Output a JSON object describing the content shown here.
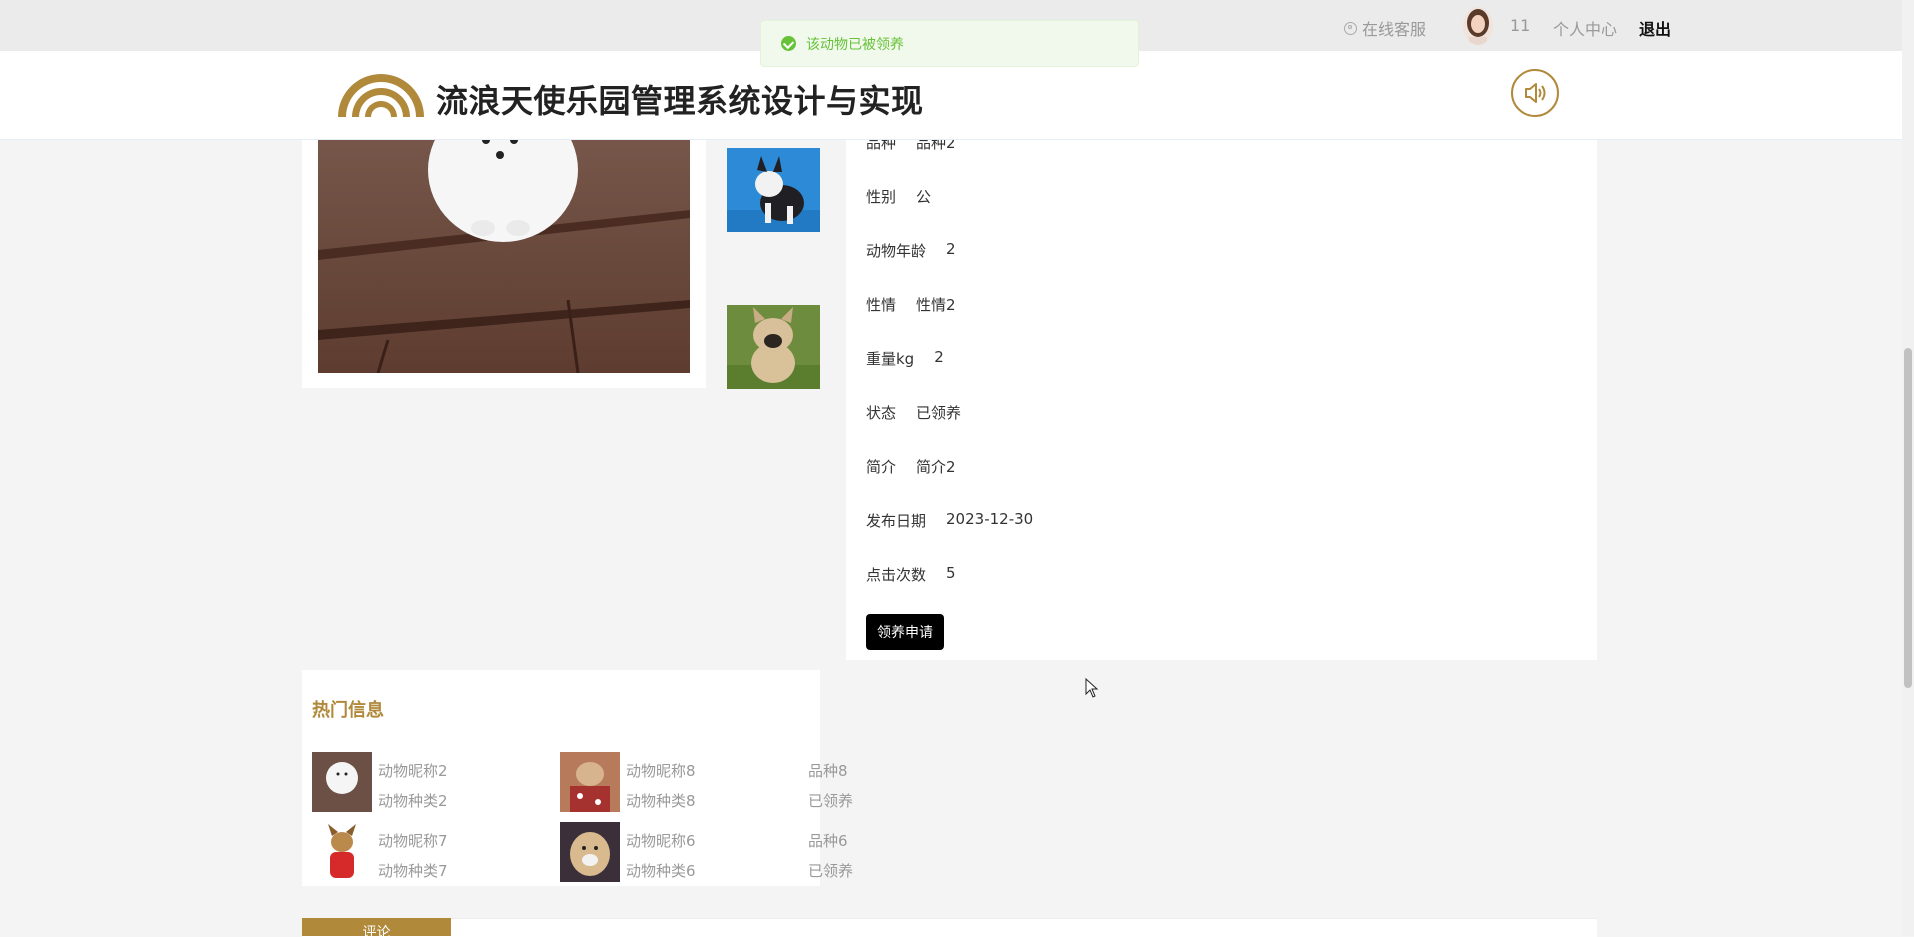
{
  "topbar": {
    "service": "在线客服",
    "username": "11",
    "center": "个人中心",
    "logout": "退出"
  },
  "toast": {
    "message": "该动物已被领养"
  },
  "header": {
    "title": "流浪天使乐园管理系统设计与实现"
  },
  "detail": {
    "rows": [
      {
        "label": "品种",
        "value": "品种2"
      },
      {
        "label": "性别",
        "value": "公"
      },
      {
        "label": "动物年龄",
        "value": "2"
      },
      {
        "label": "性情",
        "value": "性情2"
      },
      {
        "label": "重量kg",
        "value": "2"
      },
      {
        "label": "状态",
        "value": "已领养"
      },
      {
        "label": "简介",
        "value": "简介2"
      },
      {
        "label": "发布日期",
        "value": "2023-12-30"
      },
      {
        "label": "点击次数",
        "value": "5"
      }
    ],
    "adopt_button": "领养申请"
  },
  "hot": {
    "title": "热门信息",
    "items": [
      {
        "name": "动物昵称2",
        "kind": "动物种类2",
        "breed": "",
        "status": ""
      },
      {
        "name": "动物昵称8",
        "kind": "动物种类8",
        "breed": "品种8",
        "status": "已领养"
      },
      {
        "name": "动物昵称7",
        "kind": "动物种类7",
        "breed": "",
        "status": ""
      },
      {
        "name": "动物昵称6",
        "kind": "动物种类6",
        "breed": "品种6",
        "status": "已领养"
      }
    ]
  },
  "bottom": {
    "tab_label": "评论"
  },
  "colors": {
    "accent": "#b0893b",
    "success": "#67c23a",
    "topbar_bg": "#ebebeb",
    "page_bg": "#f4f4f4"
  },
  "icons": [
    "user-circle-icon",
    "success-check-icon",
    "logo-arch-icon",
    "speaker-icon",
    "mouse-cursor-icon"
  ]
}
